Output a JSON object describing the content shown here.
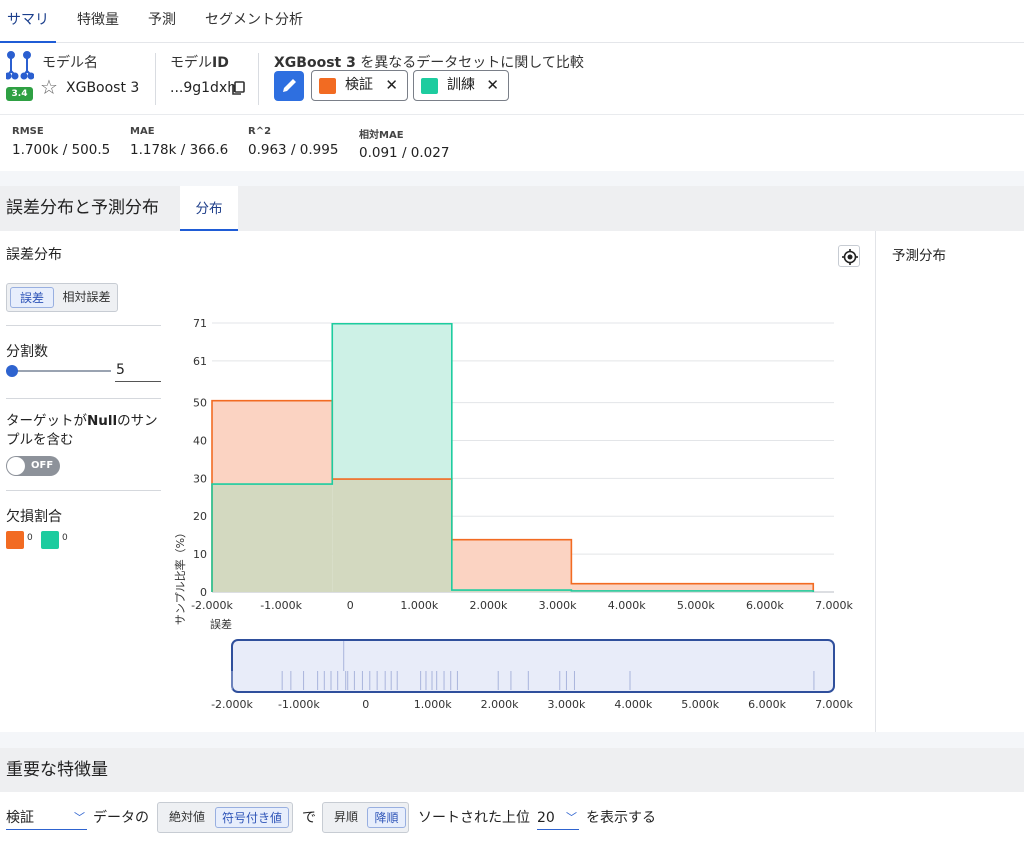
{
  "tabs": [
    "サマリ",
    "特徴量",
    "予測",
    "セグメント分析"
  ],
  "model": {
    "name_label": "モデル名",
    "version_badge": "3.4",
    "name": "XGBoost 3",
    "id_label_prefix": "モデル",
    "id_label_suffix": "ID",
    "id_value": "...9g1dxh",
    "compare_bold": "XGBoost 3",
    "compare_text": " を異なるデータセットに関して比較",
    "chips": [
      {
        "label": "検証",
        "color": "#f26b22"
      },
      {
        "label": "訓練",
        "color": "#1dcc9f"
      }
    ],
    "close_glyph": "✕"
  },
  "metrics": [
    {
      "label": "RMSE",
      "value": "1.700k / 500.5"
    },
    {
      "label": "MAE",
      "value": "1.178k / 366.6"
    },
    {
      "label": "R^2",
      "value": "0.963 / 0.995"
    },
    {
      "label": "相対MAE",
      "value": "0.091 / 0.027"
    }
  ],
  "section": {
    "title": "誤差分布と予測分布",
    "subtab": "分布"
  },
  "error_panel": {
    "title": "誤差分布",
    "seg_options": [
      "誤差",
      "相対誤差"
    ],
    "bins_label": "分割数",
    "bins_value": "5",
    "null_label_a": "ターゲットが",
    "null_label_bold": "Null",
    "null_label_b": "のサン",
    "null_label_c": "プルを含む",
    "toggle_text": "OFF",
    "missing_label": "欠損割合",
    "missing_values": [
      "0",
      "0"
    ]
  },
  "prediction_panel": {
    "title": "予測分布"
  },
  "chart_data": {
    "type": "histogram",
    "xlabel": "誤差",
    "ylabel": "サンプル比率（%）",
    "y_ticks": [
      0,
      10,
      20,
      30,
      40,
      50,
      61,
      71
    ],
    "ylim": [
      0,
      71
    ],
    "x_ticks": [
      "-2.000k",
      "-1.000k",
      "0",
      "1.000k",
      "2.000k",
      "3.000k",
      "4.000k",
      "5.000k",
      "6.000k",
      "7.000k"
    ],
    "xlim": [
      -2000,
      7000
    ],
    "series": [
      {
        "name": "検証",
        "color": "#f26b22",
        "fill": "#fbd3c2",
        "bins": [
          {
            "x0": -2000,
            "x1": -260,
            "value": 50.5
          },
          {
            "x0": -260,
            "x1": 1470,
            "value": 29.8
          },
          {
            "x0": 1470,
            "x1": 3200,
            "value": 13.8
          },
          {
            "x0": 3200,
            "x1": 6700,
            "value": 2.2
          }
        ]
      },
      {
        "name": "訓練",
        "color": "#1dcc9f",
        "fill": "#cdf1e6",
        "bins": [
          {
            "x0": -2000,
            "x1": -260,
            "value": 28.5
          },
          {
            "x0": -260,
            "x1": 1470,
            "value": 70.8
          },
          {
            "x0": 1470,
            "x1": 3200,
            "value": 0.5
          },
          {
            "x0": 3200,
            "x1": 6700,
            "value": 0.3
          }
        ]
      }
    ],
    "overlap_fill": "#d3d9c0",
    "rug_positions": [
      -2000,
      -1250,
      -1120,
      -930,
      -720,
      -620,
      -520,
      -420,
      -300,
      -270,
      -170,
      -50,
      60,
      170,
      290,
      380,
      470,
      820,
      900,
      990,
      1060,
      1170,
      1270,
      1370,
      1980,
      2170,
      2430,
      2900,
      3000,
      3120,
      3950,
      6700
    ]
  },
  "importance": {
    "title": "重要な特徴量",
    "dataset": "検証",
    "text_data": "データの",
    "abs_options": [
      "絶対値",
      "符号付き値"
    ],
    "text_de": "で",
    "sort_options": [
      "昇順",
      "降順"
    ],
    "text_sorted": "ソートされた上位",
    "top_n": "20",
    "text_show": "を表示する"
  }
}
